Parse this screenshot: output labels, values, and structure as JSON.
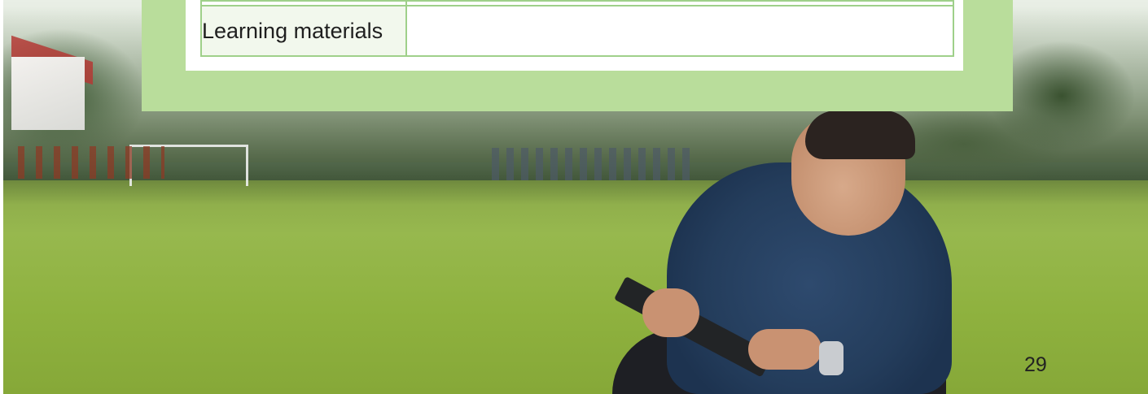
{
  "table": {
    "rows": [
      {
        "label": "",
        "value": ""
      },
      {
        "label": "Learning materials",
        "value": ""
      }
    ]
  },
  "footer": {
    "page_number": "29"
  },
  "colors": {
    "panel_green": "#b9dd9b",
    "table_border": "#9fd08a",
    "label_cell_bg": "#f2f8ed"
  }
}
